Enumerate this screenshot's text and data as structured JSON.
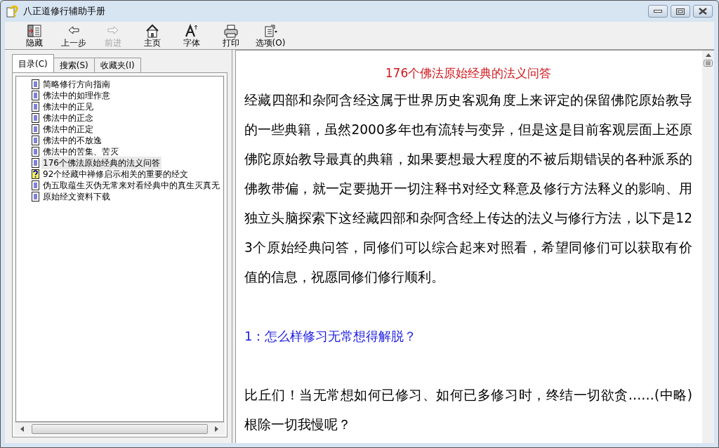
{
  "window": {
    "title": "八正道修行辅助手册"
  },
  "toolbar": [
    {
      "label": "隐藏",
      "disabled": false
    },
    {
      "label": "上一步",
      "disabled": false
    },
    {
      "label": "前进",
      "disabled": true
    },
    {
      "label": "主页",
      "disabled": false
    },
    {
      "label": "字体",
      "disabled": false
    },
    {
      "label": "打印",
      "disabled": false
    },
    {
      "label": "选项(O)",
      "disabled": false
    }
  ],
  "tabs": [
    {
      "label": "目录(C)",
      "selected": true
    },
    {
      "label": "搜索(S)",
      "selected": false
    },
    {
      "label": "收藏夹(I)",
      "selected": false
    }
  ],
  "contents": [
    {
      "kind": "page",
      "label": "简略修行方向指南",
      "selected": false
    },
    {
      "kind": "page",
      "label": "佛法中的如理作意",
      "selected": false
    },
    {
      "kind": "page",
      "label": "佛法中的正见",
      "selected": false
    },
    {
      "kind": "page",
      "label": "佛法中的正念",
      "selected": false
    },
    {
      "kind": "page",
      "label": "佛法中的正定",
      "selected": false
    },
    {
      "kind": "page",
      "label": "佛法中的不放逸",
      "selected": false
    },
    {
      "kind": "page",
      "label": "佛法中的苦集、苦灭",
      "selected": false
    },
    {
      "kind": "page",
      "label": "176个佛法原始经典的法义问答",
      "selected": true
    },
    {
      "kind": "help",
      "label": "92个经藏中禅修启示相关的重要的经文",
      "selected": false
    },
    {
      "kind": "page",
      "label": "伪五取蕴生灭伪无常来对看经典中的真生灭真无",
      "selected": false
    },
    {
      "kind": "page",
      "label": "原始经文资料下载",
      "selected": false
    }
  ],
  "document": {
    "title": "176个佛法原始经典的法义问答",
    "blocks": [
      {
        "kind": "paragraph",
        "text": "经藏四部和杂阿含经这属于世界历史客观角度上来评定的保留佛陀原始教导的一些典籍，虽然2000多年也有流转与变异，但是这是目前客观层面上还原佛陀原始教导最真的典籍，如果要想最大程度的不被后期错误的各种派系的佛教带偏，就一定要抛开一切注释书对经文释意及修行方法释义的影响、用独立头脑探索下这经藏四部和杂阿含经上传达的法义与修行方法，以下是123个原始经典问答，同修们可以综合起来对照看，希望同修们可以获取有价值的信息，祝愿同修们修行顺利。"
      },
      {
        "kind": "question",
        "text": "1：怎么样修习无常想得解脱？"
      },
      {
        "kind": "paragraph",
        "text": "比丘们！当无常想如何已修习、如何已多修习时，终结一切欲贪……(中略)根除一切我慢呢？"
      }
    ]
  }
}
